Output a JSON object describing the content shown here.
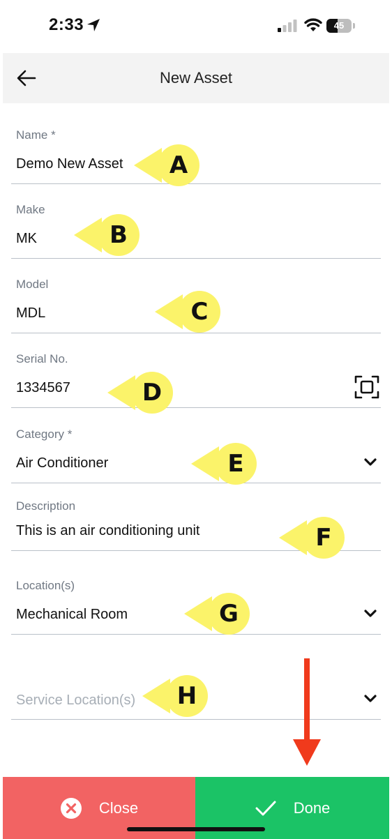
{
  "status_bar": {
    "time": "2:33",
    "battery": "45",
    "battery_level": 0.45
  },
  "header": {
    "title": "New Asset"
  },
  "form": {
    "name": {
      "label": "Name *",
      "value": "Demo New Asset"
    },
    "make": {
      "label": "Make",
      "value": "MK"
    },
    "model": {
      "label": "Model",
      "value": "MDL"
    },
    "serial": {
      "label": "Serial No.",
      "value": "1334567"
    },
    "category": {
      "label": "Category *",
      "value": "Air Conditioner"
    },
    "description": {
      "label": "Description",
      "value": "This is an air conditioning unit"
    },
    "locations": {
      "label": "Location(s)",
      "value": "Mechanical Room"
    },
    "service_locations": {
      "placeholder": "Service Location(s)"
    }
  },
  "callouts": {
    "a": "A",
    "b": "B",
    "c": "C",
    "d": "D",
    "e": "E",
    "f": "F",
    "g": "G",
    "h": "H"
  },
  "footer": {
    "close_label": "Close",
    "done_label": "Done"
  },
  "colors": {
    "close": "#f26363",
    "done": "#1bc366",
    "callout": "#fbf36a",
    "arrow": "#f03a1c"
  }
}
